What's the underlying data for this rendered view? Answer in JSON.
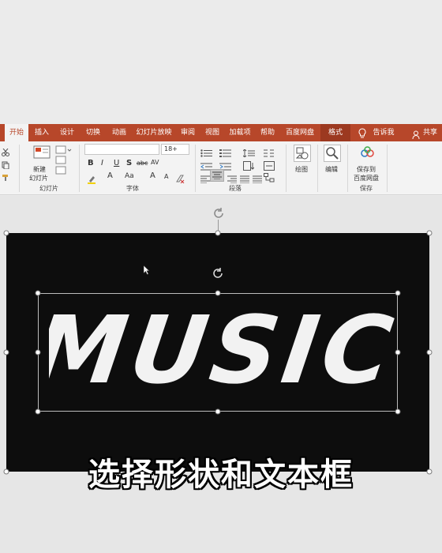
{
  "ribbon_tabs": [
    "开始",
    "插入",
    "设计",
    "切换",
    "动画",
    "幻灯片放映",
    "审阅",
    "视图",
    "加载项",
    "帮助",
    "百度网盘",
    "格式"
  ],
  "tell_me": "告诉我",
  "share": "共享",
  "slides_group": {
    "new_slide": "新建",
    "new_slide_line2": "幻灯片",
    "label": "幻灯片"
  },
  "font_group": {
    "font_name": "",
    "font_size": "18+",
    "bold": "B",
    "italic": "I",
    "underline": "U",
    "shadow": "S",
    "strike": "abc",
    "spacing": "AV",
    "font_color": "A",
    "case": "Aa",
    "grow": "A",
    "shrink": "A",
    "label": "字体"
  },
  "paragraph_group": {
    "label": "段落"
  },
  "drawing_group": {
    "label": "绘图"
  },
  "editing_group": {
    "label": "编辑"
  },
  "save_group": {
    "button_line1": "保存到",
    "button_line2": "百度网盘",
    "label": "保存"
  },
  "slide_text": "MUSIC",
  "subtitle": "选择形状和文本框",
  "colors": {
    "ribbon_accent": "#b7472a",
    "slide_bg": "#0d0d0d"
  },
  "icons": [
    "cut-icon",
    "copy-icon",
    "format-painter-icon",
    "new-slide-icon",
    "bullets-icon",
    "numbering-icon",
    "drawing-icon",
    "search-icon",
    "baidu-cloud-icon",
    "lightbulb-icon",
    "user-icon",
    "rotate-icon",
    "cursor-icon"
  ]
}
